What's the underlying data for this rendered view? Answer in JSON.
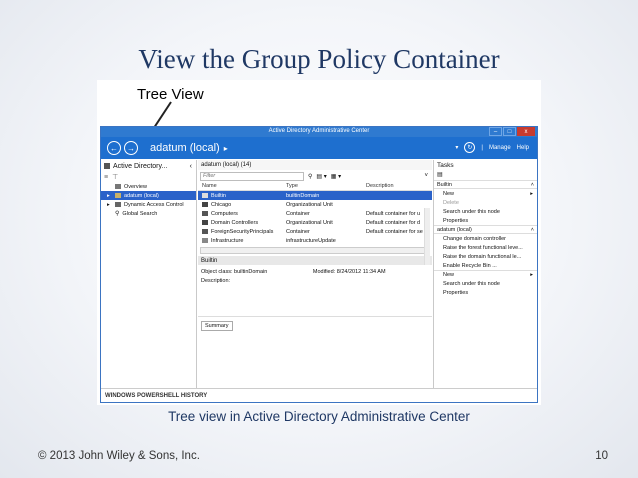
{
  "slide": {
    "title": "View the Group Policy Container",
    "annotation": "Tree View",
    "caption": "Tree view in Active Directory Administrative Center",
    "footer_left": "© 2013 John Wiley & Sons, Inc.",
    "page_number": "10"
  },
  "window": {
    "title": "Active Directory Administrative Center",
    "min": "–",
    "max": "□",
    "close": "x"
  },
  "navbar": {
    "back": "←",
    "forward": "→",
    "breadcrumb": "adatum (local)",
    "crumb_chevron": "▸",
    "refresh": "↻",
    "manage": "Manage",
    "help": "Help"
  },
  "left_pane": {
    "title": "Active Directory...",
    "collapse": "‹",
    "items": [
      {
        "label": "Overview",
        "expander": ""
      },
      {
        "label": "adatum (local)",
        "expander": "▸"
      },
      {
        "label": "Dynamic Access Control",
        "expander": "▸"
      },
      {
        "label": "Global Search",
        "expander": ""
      }
    ]
  },
  "center": {
    "header": "adatum (local)  (14)",
    "filter_placeholder": "Filter",
    "columns": {
      "name": "Name",
      "type": "Type",
      "description": "Description"
    },
    "rows": [
      {
        "name": "Builtin",
        "type": "builtinDomain",
        "description": ""
      },
      {
        "name": "Chicago",
        "type": "Organizational Unit",
        "description": ""
      },
      {
        "name": "Computers",
        "type": "Container",
        "description": "Default container for u"
      },
      {
        "name": "Domain Controllers",
        "type": "Organizational Unit",
        "description": "Default container for d"
      },
      {
        "name": "ForeignSecurityPrincipals",
        "type": "Container",
        "description": "Default container for se"
      },
      {
        "name": "Infrastructure",
        "type": "infrastructureUpdate",
        "description": ""
      }
    ],
    "detail_title": "Builtin",
    "detail_class_label": "Object class:",
    "detail_class_value": "builtinDomain",
    "detail_modified_label": "Modified:",
    "detail_modified_value": "8/24/2012 11:34 AM",
    "detail_description_label": "Description:",
    "summary_tab": "Summary"
  },
  "tasks": {
    "title": "Tasks",
    "group1": "Builtin",
    "group1_items": [
      {
        "label": "New",
        "submenu": "▸",
        "disabled": false
      },
      {
        "label": "Delete",
        "submenu": "",
        "disabled": true
      },
      {
        "label": "Search under this node",
        "submenu": "",
        "disabled": false
      },
      {
        "label": "Properties",
        "submenu": "",
        "disabled": false
      }
    ],
    "group2": "adatum (local)",
    "group2_items": [
      {
        "label": "Change domain controller",
        "submenu": ""
      },
      {
        "label": "Raise the forest functional leve...",
        "submenu": ""
      },
      {
        "label": "Raise the domain functional le...",
        "submenu": ""
      },
      {
        "label": "Enable Recycle Bin ...",
        "submenu": ""
      },
      {
        "label": "New",
        "submenu": "▸"
      },
      {
        "label": "Search under this node",
        "submenu": ""
      },
      {
        "label": "Properties",
        "submenu": ""
      }
    ],
    "collapse": "˄"
  },
  "powershell_bar": "WINDOWS POWERSHELL HISTORY"
}
